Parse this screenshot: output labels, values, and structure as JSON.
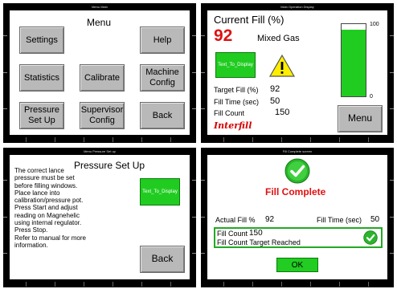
{
  "menu_main": {
    "window_title": "Menu Main",
    "title": "Menu",
    "buttons": {
      "settings": "Settings",
      "help": "Help",
      "statistics": "Statistics",
      "calibrate": "Calibrate",
      "machine_config_1": "Machine",
      "machine_config_2": "Config",
      "pressure_setup_1": "Pressure",
      "pressure_setup_2": "Set Up",
      "supervisor_config_1": "Supervisor",
      "supervisor_config_2": "Config",
      "back": "Back"
    }
  },
  "main_operation": {
    "window_title": "Main Operation Display",
    "current_fill_label": "Current Fill (%)",
    "current_fill_value": "92",
    "gas_type": "Mixed Gas",
    "text_to_display": "Text_To_Display",
    "target_fill_label": "Target Fill (%)",
    "target_fill_value": "92",
    "fill_time_label": "Fill Time (sec)",
    "fill_time_value": "50",
    "fill_count_label": "Fill Count",
    "fill_count_value": "150",
    "brand": "Interfill",
    "bar_max_label": "100",
    "bar_min_label": "0",
    "bar_level_fraction": 0.92,
    "menu_button": "Menu"
  },
  "pressure_setup": {
    "window_title": "Menu Pressure Set up",
    "title": "Pressure Set Up",
    "instructions": [
      "The correct lance",
      "pressure must be set",
      "before filling windows.",
      "Place lance into",
      "calibration/pressure pot.",
      "Press Start and adjust",
      "reading on Magnehelic",
      "using internal regulator.",
      "Press Stop.",
      "Refer to manual for more",
      "information."
    ],
    "text_to_display": "Text_To_Display",
    "back_button": "Back"
  },
  "fill_complete": {
    "window_title": "Fill Complete screen",
    "title": "Fill Complete",
    "actual_fill_label": "Actual Fill %",
    "actual_fill_value": "92",
    "fill_time_label": "Fill Time (sec)",
    "fill_time_value": "50",
    "fill_count_label": "Fill Count",
    "fill_count_value": "150",
    "target_reached": "Fill Count Target Reached",
    "ok_button": "OK"
  },
  "colors": {
    "button_gray": "#b9b9b9",
    "green": "#21cc21",
    "red": "#e01010",
    "warning_yellow": "#ffee00"
  }
}
